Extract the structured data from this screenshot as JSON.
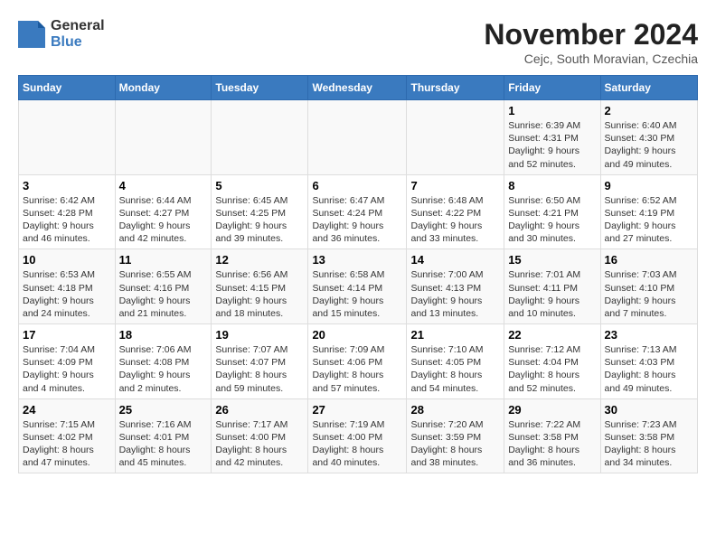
{
  "logo": {
    "general": "General",
    "blue": "Blue"
  },
  "title": "November 2024",
  "subtitle": "Cejc, South Moravian, Czechia",
  "days_header": [
    "Sunday",
    "Monday",
    "Tuesday",
    "Wednesday",
    "Thursday",
    "Friday",
    "Saturday"
  ],
  "weeks": [
    [
      {
        "day": "",
        "content": ""
      },
      {
        "day": "",
        "content": ""
      },
      {
        "day": "",
        "content": ""
      },
      {
        "day": "",
        "content": ""
      },
      {
        "day": "",
        "content": ""
      },
      {
        "day": "1",
        "content": "Sunrise: 6:39 AM\nSunset: 4:31 PM\nDaylight: 9 hours\nand 52 minutes."
      },
      {
        "day": "2",
        "content": "Sunrise: 6:40 AM\nSunset: 4:30 PM\nDaylight: 9 hours\nand 49 minutes."
      }
    ],
    [
      {
        "day": "3",
        "content": "Sunrise: 6:42 AM\nSunset: 4:28 PM\nDaylight: 9 hours\nand 46 minutes."
      },
      {
        "day": "4",
        "content": "Sunrise: 6:44 AM\nSunset: 4:27 PM\nDaylight: 9 hours\nand 42 minutes."
      },
      {
        "day": "5",
        "content": "Sunrise: 6:45 AM\nSunset: 4:25 PM\nDaylight: 9 hours\nand 39 minutes."
      },
      {
        "day": "6",
        "content": "Sunrise: 6:47 AM\nSunset: 4:24 PM\nDaylight: 9 hours\nand 36 minutes."
      },
      {
        "day": "7",
        "content": "Sunrise: 6:48 AM\nSunset: 4:22 PM\nDaylight: 9 hours\nand 33 minutes."
      },
      {
        "day": "8",
        "content": "Sunrise: 6:50 AM\nSunset: 4:21 PM\nDaylight: 9 hours\nand 30 minutes."
      },
      {
        "day": "9",
        "content": "Sunrise: 6:52 AM\nSunset: 4:19 PM\nDaylight: 9 hours\nand 27 minutes."
      }
    ],
    [
      {
        "day": "10",
        "content": "Sunrise: 6:53 AM\nSunset: 4:18 PM\nDaylight: 9 hours\nand 24 minutes."
      },
      {
        "day": "11",
        "content": "Sunrise: 6:55 AM\nSunset: 4:16 PM\nDaylight: 9 hours\nand 21 minutes."
      },
      {
        "day": "12",
        "content": "Sunrise: 6:56 AM\nSunset: 4:15 PM\nDaylight: 9 hours\nand 18 minutes."
      },
      {
        "day": "13",
        "content": "Sunrise: 6:58 AM\nSunset: 4:14 PM\nDaylight: 9 hours\nand 15 minutes."
      },
      {
        "day": "14",
        "content": "Sunrise: 7:00 AM\nSunset: 4:13 PM\nDaylight: 9 hours\nand 13 minutes."
      },
      {
        "day": "15",
        "content": "Sunrise: 7:01 AM\nSunset: 4:11 PM\nDaylight: 9 hours\nand 10 minutes."
      },
      {
        "day": "16",
        "content": "Sunrise: 7:03 AM\nSunset: 4:10 PM\nDaylight: 9 hours\nand 7 minutes."
      }
    ],
    [
      {
        "day": "17",
        "content": "Sunrise: 7:04 AM\nSunset: 4:09 PM\nDaylight: 9 hours\nand 4 minutes."
      },
      {
        "day": "18",
        "content": "Sunrise: 7:06 AM\nSunset: 4:08 PM\nDaylight: 9 hours\nand 2 minutes."
      },
      {
        "day": "19",
        "content": "Sunrise: 7:07 AM\nSunset: 4:07 PM\nDaylight: 8 hours\nand 59 minutes."
      },
      {
        "day": "20",
        "content": "Sunrise: 7:09 AM\nSunset: 4:06 PM\nDaylight: 8 hours\nand 57 minutes."
      },
      {
        "day": "21",
        "content": "Sunrise: 7:10 AM\nSunset: 4:05 PM\nDaylight: 8 hours\nand 54 minutes."
      },
      {
        "day": "22",
        "content": "Sunrise: 7:12 AM\nSunset: 4:04 PM\nDaylight: 8 hours\nand 52 minutes."
      },
      {
        "day": "23",
        "content": "Sunrise: 7:13 AM\nSunset: 4:03 PM\nDaylight: 8 hours\nand 49 minutes."
      }
    ],
    [
      {
        "day": "24",
        "content": "Sunrise: 7:15 AM\nSunset: 4:02 PM\nDaylight: 8 hours\nand 47 minutes."
      },
      {
        "day": "25",
        "content": "Sunrise: 7:16 AM\nSunset: 4:01 PM\nDaylight: 8 hours\nand 45 minutes."
      },
      {
        "day": "26",
        "content": "Sunrise: 7:17 AM\nSunset: 4:00 PM\nDaylight: 8 hours\nand 42 minutes."
      },
      {
        "day": "27",
        "content": "Sunrise: 7:19 AM\nSunset: 4:00 PM\nDaylight: 8 hours\nand 40 minutes."
      },
      {
        "day": "28",
        "content": "Sunrise: 7:20 AM\nSunset: 3:59 PM\nDaylight: 8 hours\nand 38 minutes."
      },
      {
        "day": "29",
        "content": "Sunrise: 7:22 AM\nSunset: 3:58 PM\nDaylight: 8 hours\nand 36 minutes."
      },
      {
        "day": "30",
        "content": "Sunrise: 7:23 AM\nSunset: 3:58 PM\nDaylight: 8 hours\nand 34 minutes."
      }
    ]
  ]
}
